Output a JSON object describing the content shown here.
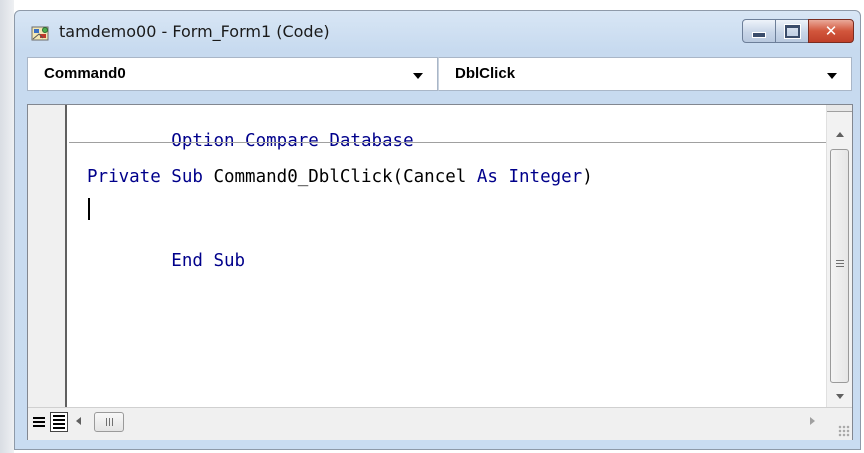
{
  "window": {
    "title": "tamdemo00 - Form_Form1 (Code)",
    "icon": "vba-module-icon",
    "controls": {
      "minimize_icon": "minimize-icon",
      "maximize_icon": "maximize-icon",
      "close_label": "✕"
    }
  },
  "object_combo": {
    "value": "Command0"
  },
  "procedure_combo": {
    "value": "DblClick"
  },
  "code": {
    "declaration": {
      "keyword": "Option Compare Database"
    },
    "sub_header": {
      "kw1": "Private Sub",
      "name": " Command0_DblClick(Cancel ",
      "kw2": "As",
      "sp": " ",
      "kw3": "Integer",
      "tail": ")"
    },
    "sub_footer": {
      "keyword": "End Sub"
    }
  },
  "colors": {
    "keyword": "#00008b",
    "text": "#000000",
    "close_button": "#c0402a"
  }
}
